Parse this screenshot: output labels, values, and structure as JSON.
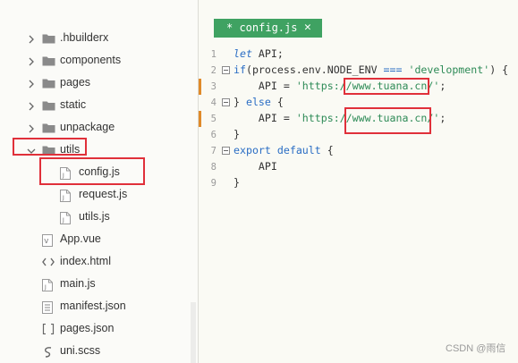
{
  "sidebar": {
    "items": [
      {
        "label": ".hbuilderx",
        "type": "folder",
        "expanded": false
      },
      {
        "label": "components",
        "type": "folder",
        "expanded": false
      },
      {
        "label": "pages",
        "type": "folder",
        "expanded": false
      },
      {
        "label": "static",
        "type": "folder",
        "expanded": false
      },
      {
        "label": "unpackage",
        "type": "folder",
        "expanded": false
      },
      {
        "label": "utils",
        "type": "folder",
        "expanded": true
      },
      {
        "label": "config.js",
        "type": "js-file"
      },
      {
        "label": "request.js",
        "type": "js-file"
      },
      {
        "label": "utils.js",
        "type": "js-file"
      },
      {
        "label": "App.vue",
        "type": "vue-file"
      },
      {
        "label": "index.html",
        "type": "html-file"
      },
      {
        "label": "main.js",
        "type": "js-file"
      },
      {
        "label": "manifest.json",
        "type": "json-file"
      },
      {
        "label": "pages.json",
        "type": "json-file"
      },
      {
        "label": "uni.scss",
        "type": "scss-file"
      }
    ]
  },
  "editor": {
    "tab": {
      "label": "* config.js",
      "close_glyph": "✕"
    },
    "lines": [
      {
        "num": "1",
        "parts": [
          {
            "t": "let",
            "c": "kw-italic"
          },
          {
            "t": " API;",
            "c": ""
          }
        ]
      },
      {
        "num": "2",
        "parts": [
          {
            "t": "if",
            "c": "kw"
          },
          {
            "t": "(process.env.NODE_ENV ",
            "c": ""
          },
          {
            "t": "===",
            "c": "op"
          },
          {
            "t": " ",
            "c": ""
          },
          {
            "t": "'development'",
            "c": "str"
          },
          {
            "t": ") {",
            "c": ""
          }
        ]
      },
      {
        "num": "3",
        "parts": [
          {
            "t": "    API = ",
            "c": ""
          },
          {
            "t": "'https://www.tuana.cn/'",
            "c": "str"
          },
          {
            "t": ";",
            "c": ""
          }
        ]
      },
      {
        "num": "4",
        "parts": [
          {
            "t": "} ",
            "c": ""
          },
          {
            "t": "else",
            "c": "kw"
          },
          {
            "t": " {",
            "c": ""
          }
        ]
      },
      {
        "num": "5",
        "parts": [
          {
            "t": "    API = ",
            "c": ""
          },
          {
            "t": "'https://www.tuana.cn/'",
            "c": "str"
          },
          {
            "t": ";",
            "c": ""
          }
        ]
      },
      {
        "num": "6",
        "parts": [
          {
            "t": "}",
            "c": ""
          }
        ]
      },
      {
        "num": "7",
        "parts": [
          {
            "t": "export",
            "c": "kw"
          },
          {
            "t": " ",
            "c": ""
          },
          {
            "t": "default",
            "c": "kw"
          },
          {
            "t": " {",
            "c": ""
          }
        ]
      },
      {
        "num": "8",
        "parts": [
          {
            "t": "    API",
            "c": ""
          }
        ]
      },
      {
        "num": "9",
        "parts": [
          {
            "t": "}",
            "c": ""
          }
        ]
      }
    ]
  },
  "watermark": "CSDN @雨信",
  "colors": {
    "tab_bg": "#3fa262",
    "keyword": "#2a6dc4",
    "string": "#2e8b57",
    "highlight_box": "#e0303a",
    "change_marker": "#e08a2a"
  },
  "icons": {
    "folder": "folder-icon",
    "js": "js-file-icon",
    "vue": "vue-file-icon",
    "html": "code-brackets-icon",
    "json": "json-file-icon",
    "scss": "scss-swirl-icon",
    "chevron_right": "chevron-right-icon",
    "chevron_down": "chevron-down-icon"
  }
}
